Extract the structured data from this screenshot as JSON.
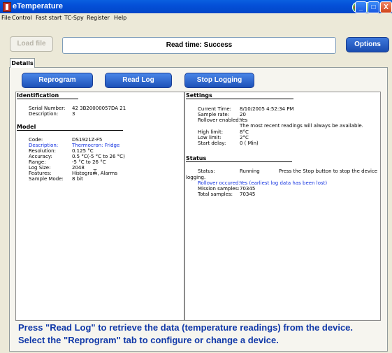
{
  "window": {
    "title": "eTemperature",
    "min": "_",
    "max": "□",
    "close": "X"
  },
  "menu": [
    "File",
    "Control",
    "Fast start",
    "TC-Spy",
    "Register",
    "Help"
  ],
  "toolbar": {
    "load_file": "Load file",
    "status": "Read time: Success",
    "options": "Options"
  },
  "tabs": {
    "details": "Details"
  },
  "buttons": {
    "reprogram": "Reprogram",
    "read_log": "Read Log",
    "stop_logging": "Stop Logging"
  },
  "identification": {
    "heading": "Identification",
    "rows": [
      {
        "label": "Serial Number:",
        "value": "42 3B20000057DA 21"
      },
      {
        "label": "Description:",
        "value": "3"
      }
    ]
  },
  "model": {
    "heading": "Model",
    "rows": [
      {
        "label": "Code:",
        "value": "DS1921Z-F5"
      },
      {
        "label": "Description:",
        "value": "Thermocron: Fridge"
      },
      {
        "label": "Resolution:",
        "value": "0.125 °C"
      },
      {
        "label": "Accuracy:",
        "value": "0.5 °C(-5 °C to 26 °C)"
      },
      {
        "label": "Range:",
        "value": "-5 °C to 26 °C"
      },
      {
        "label": "Log Size:",
        "value": "2048"
      },
      {
        "label": "Features:",
        "value": "Histogram, Alarms"
      },
      {
        "label": "Sample Mode:",
        "value": "8 bit"
      }
    ]
  },
  "settings": {
    "heading": "Settings",
    "rows": [
      {
        "label": "Current Time:",
        "value": "8/10/2005 4:52:34 PM"
      },
      {
        "label": "Sample rate:",
        "value": "20"
      },
      {
        "label": "Rollover enabled:",
        "value": "Yes"
      },
      {
        "label": "",
        "value": "The most recent readings will always be available."
      },
      {
        "label": "High limit:",
        "value": "8°C"
      },
      {
        "label": "Low limit:",
        "value": "2°C"
      },
      {
        "label": "Start delay:",
        "value": "0 ( Min)"
      }
    ]
  },
  "status": {
    "heading": "Status",
    "status_label": "Status:",
    "status_value": "Running",
    "status_note": "Press the Stop button to stop the device",
    "status_note_cont": "logging.",
    "rollover_label": "Rollover occured:",
    "rollover_value": "Yes (earliest log data has been lost)",
    "mission_label": "Mission samples:",
    "mission_value": "70345",
    "total_label": "Total samples:",
    "total_value": "70345"
  },
  "footer": {
    "line1": "Press \"Read Log\" to retrieve the data (temperature readings) from the device.",
    "line2": "Select the \"Reprogram\" tab to configure or change a device."
  },
  "colors": {
    "titlebar": "#0450D8",
    "button": "#1D52B8",
    "footer_text": "#1038A8",
    "link_text": "#1030E0"
  }
}
